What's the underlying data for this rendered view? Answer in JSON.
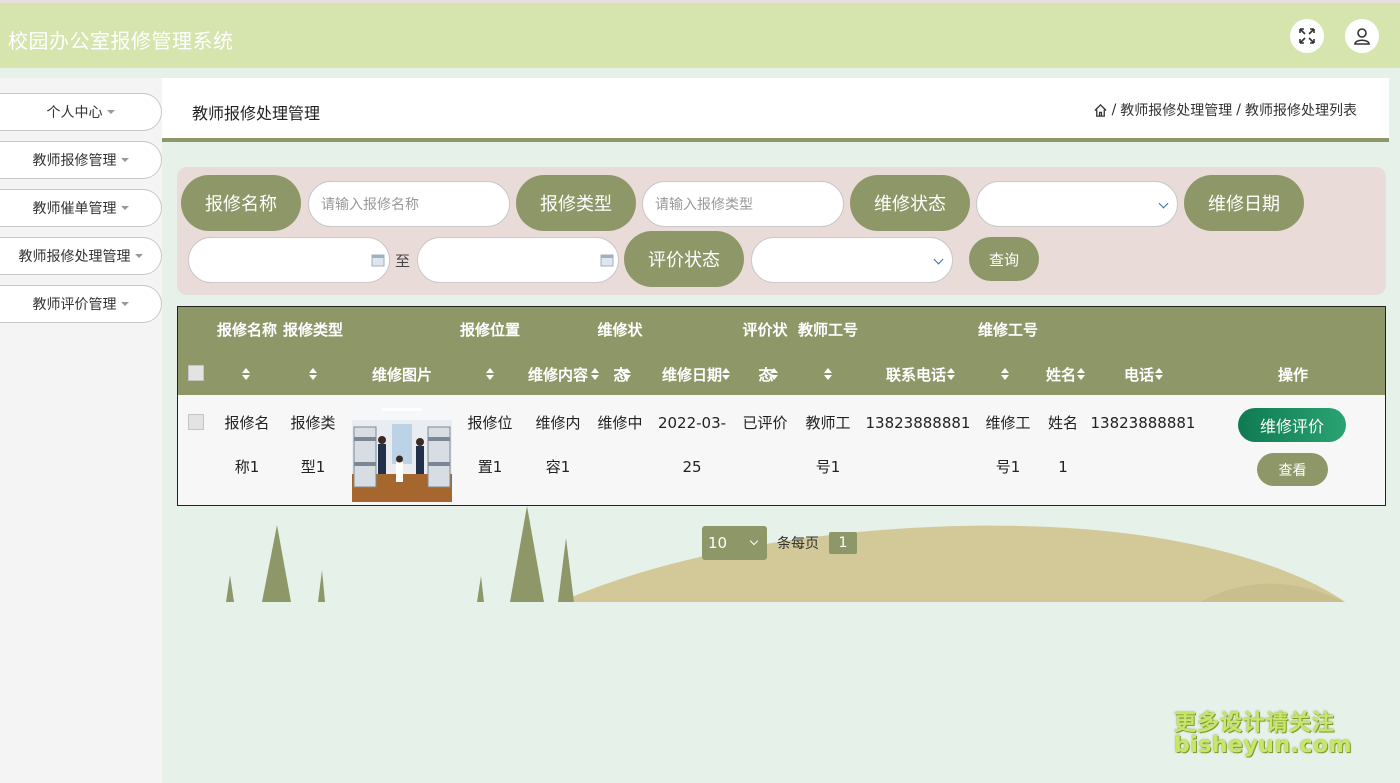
{
  "header": {
    "title": "校园办公室报修管理系统",
    "fullscreen_icon": "expand-icon",
    "user_icon": "user-icon"
  },
  "sidebar": {
    "items": [
      {
        "label": "个人中心"
      },
      {
        "label": "教师报修管理"
      },
      {
        "label": "教师催单管理"
      },
      {
        "label": "教师报修处理管理"
      },
      {
        "label": "教师评价管理"
      }
    ]
  },
  "page": {
    "title": "教师报修处理管理",
    "breadcrumb": [
      "教师报修处理管理",
      "教师报修处理列表"
    ],
    "breadcrumb_sep": "/"
  },
  "search": {
    "name_label": "报修名称",
    "name_placeholder": "请输入报修名称",
    "type_label": "报修类型",
    "type_placeholder": "请输入报修类型",
    "status_label": "维修状态",
    "date_label": "维修日期",
    "date_to": "至",
    "eval_label": "评价状态",
    "query_button": "查询"
  },
  "table": {
    "headers": {
      "name": [
        "报修名称"
      ],
      "type": [
        "报修类型"
      ],
      "image": [
        "维修图片"
      ],
      "location": [
        "报修位置"
      ],
      "content": [
        "维修内容"
      ],
      "status": [
        "维修状",
        "态"
      ],
      "date": [
        "维修日期"
      ],
      "eval": [
        "评价状",
        "态"
      ],
      "teacher_id": [
        "教师工号"
      ],
      "phone": [
        "联系电话"
      ],
      "worker_id": [
        "维修工号"
      ],
      "worker_name": [
        "姓名"
      ],
      "worker_phone": [
        "电话"
      ],
      "ops": [
        "操作"
      ]
    },
    "rows": [
      {
        "name": [
          "报修名",
          "称1"
        ],
        "type": [
          "报修类",
          "型1"
        ],
        "location": [
          "报修位",
          "置1"
        ],
        "content": [
          "维修内",
          "容1"
        ],
        "status": [
          "维修中"
        ],
        "date": [
          "2022-03-",
          "25"
        ],
        "eval": [
          "已评价"
        ],
        "teacher_id": [
          "教师工",
          "号1"
        ],
        "phone": [
          "13823888881"
        ],
        "worker_id": [
          "维修工",
          "号1"
        ],
        "worker_name": [
          "姓名",
          "1"
        ],
        "worker_phone": [
          "13823888881"
        ],
        "eval_button": "维修评价",
        "view_button": "查看"
      }
    ]
  },
  "pager": {
    "page_size": "10",
    "per_page_text": "条每页",
    "current_page": "1"
  },
  "watermark": {
    "line1": "更多设计请关注",
    "line2": "bisheyun.com"
  },
  "colors": {
    "header_bg": "#d5e5ad",
    "accent": "#8e9768",
    "search_bg": "#e8dbd8",
    "eval_button": "#1a8a5e",
    "page_bg": "#e6f1ea"
  }
}
